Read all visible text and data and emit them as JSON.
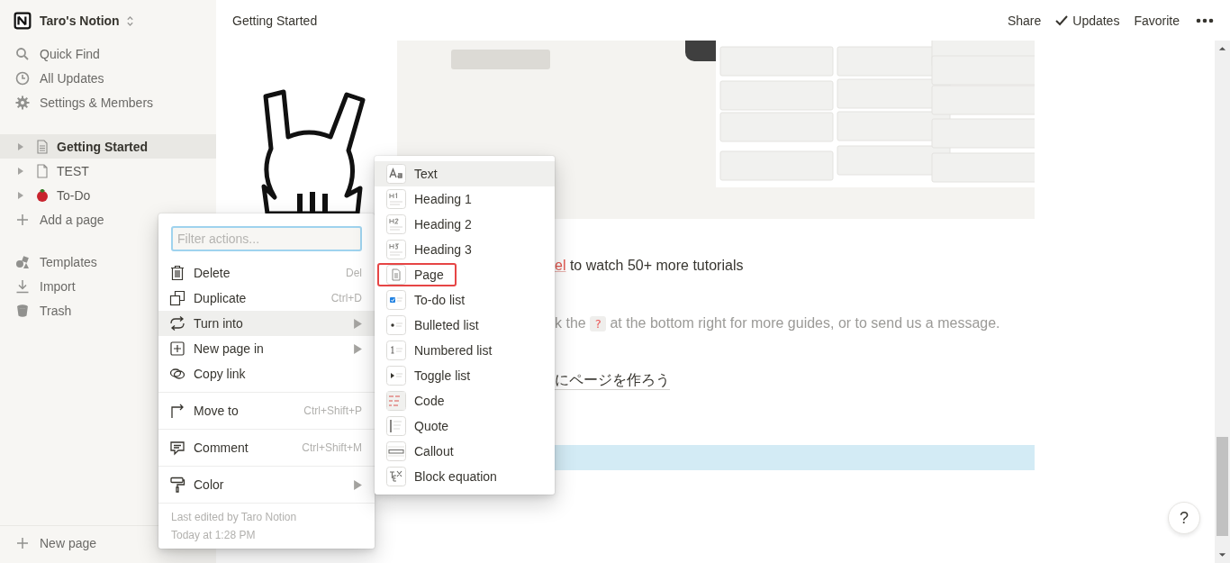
{
  "sidebar": {
    "workspace": "Taro's Notion",
    "nav": [
      {
        "label": "Quick Find",
        "kind": "search"
      },
      {
        "label": "All Updates",
        "kind": "clock"
      },
      {
        "label": "Settings & Members",
        "kind": "gear"
      }
    ],
    "pages": [
      {
        "label": "Getting Started",
        "kind": "doc",
        "selected": true
      },
      {
        "label": "TEST",
        "kind": "blank",
        "selected": false
      },
      {
        "label": "To-Do",
        "kind": "tomato",
        "selected": false
      }
    ],
    "add_page": "Add a page",
    "tools": [
      {
        "label": "Templates",
        "kind": "shapes"
      },
      {
        "label": "Import",
        "kind": "download"
      },
      {
        "label": "Trash",
        "kind": "bin"
      }
    ],
    "new_page": "New page"
  },
  "topbar": {
    "breadcrumb": "Getting Started",
    "actions": [
      {
        "label": "Share",
        "checked": false
      },
      {
        "label": "Updates",
        "checked": true
      },
      {
        "label": "Favorite",
        "checked": false
      }
    ]
  },
  "content": {
    "lines": [
      {
        "kind": "link",
        "link": "el",
        "text": "to watch 50+ more tutorials"
      },
      {
        "kind": "code",
        "before": "k the",
        "code": "?",
        "after": "at the bottom right for more guides, or to send us a message."
      },
      {
        "kind": "underlined",
        "text": "にページを作ろう"
      }
    ]
  },
  "help_button": "?",
  "context_menu": {
    "filter_placeholder": "Filter actions...",
    "groups": [
      [
        {
          "label": "Delete",
          "kind": "trash",
          "shortcut": "Del",
          "has_submenu": false,
          "selected": false
        },
        {
          "label": "Duplicate",
          "kind": "duplicate",
          "shortcut": "Ctrl+D",
          "has_submenu": false,
          "selected": false
        },
        {
          "label": "Turn into",
          "kind": "turn",
          "has_submenu": true,
          "selected": true
        },
        {
          "label": "New page in",
          "kind": "plus-box",
          "has_submenu": true,
          "selected": false
        },
        {
          "label": "Copy link",
          "kind": "link",
          "has_submenu": false,
          "selected": false
        }
      ],
      [
        {
          "label": "Move to",
          "kind": "move",
          "shortcut": "Ctrl+Shift+P",
          "has_submenu": false,
          "selected": false
        }
      ],
      [
        {
          "label": "Comment",
          "kind": "comment",
          "shortcut": "Ctrl+Shift+M",
          "has_submenu": false,
          "selected": false
        }
      ],
      [
        {
          "label": "Color",
          "kind": "roller",
          "has_submenu": true,
          "selected": false
        }
      ]
    ],
    "footer": [
      "Last edited by Taro Notion",
      "Today at 1:28 PM"
    ]
  },
  "turn_into_menu": [
    {
      "label": "Text",
      "kind": "text",
      "selected": true,
      "highlighted": false
    },
    {
      "label": "Heading 1",
      "kind": "h1",
      "selected": false,
      "highlighted": false
    },
    {
      "label": "Heading 2",
      "kind": "h2",
      "selected": false,
      "highlighted": false
    },
    {
      "label": "Heading 3",
      "kind": "h3",
      "selected": false,
      "highlighted": false
    },
    {
      "label": "Page",
      "kind": "page",
      "selected": false,
      "highlighted": true
    },
    {
      "label": "To-do list",
      "kind": "todo",
      "selected": false,
      "highlighted": false
    },
    {
      "label": "Bulleted list",
      "kind": "bullet",
      "selected": false,
      "highlighted": false
    },
    {
      "label": "Numbered list",
      "kind": "numbered",
      "selected": false,
      "highlighted": false
    },
    {
      "label": "Toggle list",
      "kind": "toggle",
      "selected": false,
      "highlighted": false
    },
    {
      "label": "Code",
      "kind": "code",
      "selected": false,
      "highlighted": false
    },
    {
      "label": "Quote",
      "kind": "quote",
      "selected": false,
      "highlighted": false
    },
    {
      "label": "Callout",
      "kind": "callout",
      "selected": false,
      "highlighted": false
    },
    {
      "label": "Block equation",
      "kind": "equation",
      "selected": false,
      "highlighted": false
    }
  ]
}
